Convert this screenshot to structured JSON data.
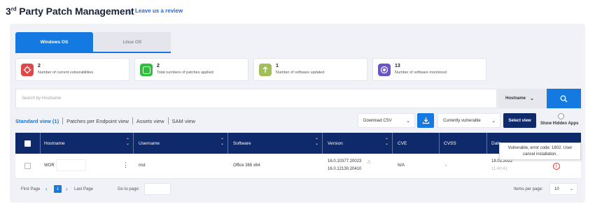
{
  "header": {
    "title_prefix": "3",
    "title_sup": "rd",
    "title_rest": " Party Patch Management",
    "review_link": "Leave us a review",
    "review_icon": "star-icon"
  },
  "tabs": [
    {
      "label": "Windows OS",
      "active": true
    },
    {
      "label": "Linux OS",
      "active": false
    }
  ],
  "summary_cards": [
    {
      "count": "2",
      "label": "Number of current vulnerabilities",
      "icon": "crosshair-icon",
      "color": "#e04848"
    },
    {
      "count": "2",
      "label": "Total numbers of patches applied",
      "icon": "patch-icon",
      "color": "#2fbf3b"
    },
    {
      "count": "1",
      "label": "Number of software updated",
      "icon": "upload-arrow-icon",
      "color": "#a1be58"
    },
    {
      "count": "13",
      "label": "Number of software monitored",
      "icon": "monitor-icon",
      "color": "#6a55c8"
    }
  ],
  "search": {
    "placeholder": "Search by Hostname",
    "filter_label": "Hostname"
  },
  "views": [
    {
      "label": "Standard view (1)",
      "active": true
    },
    {
      "label": "Patches per Endpoint view",
      "active": false
    },
    {
      "label": "Assets view",
      "active": false
    },
    {
      "label": "SAM view",
      "active": false
    }
  ],
  "toolbar": {
    "download_label": "Download CSV",
    "filter_label": "Currently vulnerable",
    "select_view_label": "Select view",
    "show_hidden_label": "Show Hidden Apps"
  },
  "table": {
    "columns": [
      "Hostname",
      "Username",
      "Software",
      "Version",
      "CVE",
      "CVSS",
      "Date"
    ],
    "rows": [
      {
        "hostname": "WOR",
        "username": "mst",
        "software": "Office 365 x64",
        "version_current": "16.0.10377.20023",
        "version_latest": "16.0.12130.20410",
        "cve": "N/A",
        "cvss": "-",
        "date": "18.01.2022",
        "time": "11:40:41"
      }
    ]
  },
  "tooltip": {
    "line1": "Vulnerable, error code: 1802. User",
    "line2": "cancel installation."
  },
  "pagination": {
    "first": "First Page",
    "page": "1",
    "last": "Last Page",
    "goto_label": "Go to page:",
    "ipp_label": "Items per page:",
    "ipp_value": "10"
  },
  "colors": {
    "accent": "#1479e0",
    "table_header": "#0f2a6a",
    "error": "#e0302a",
    "warning": "#e89227"
  }
}
